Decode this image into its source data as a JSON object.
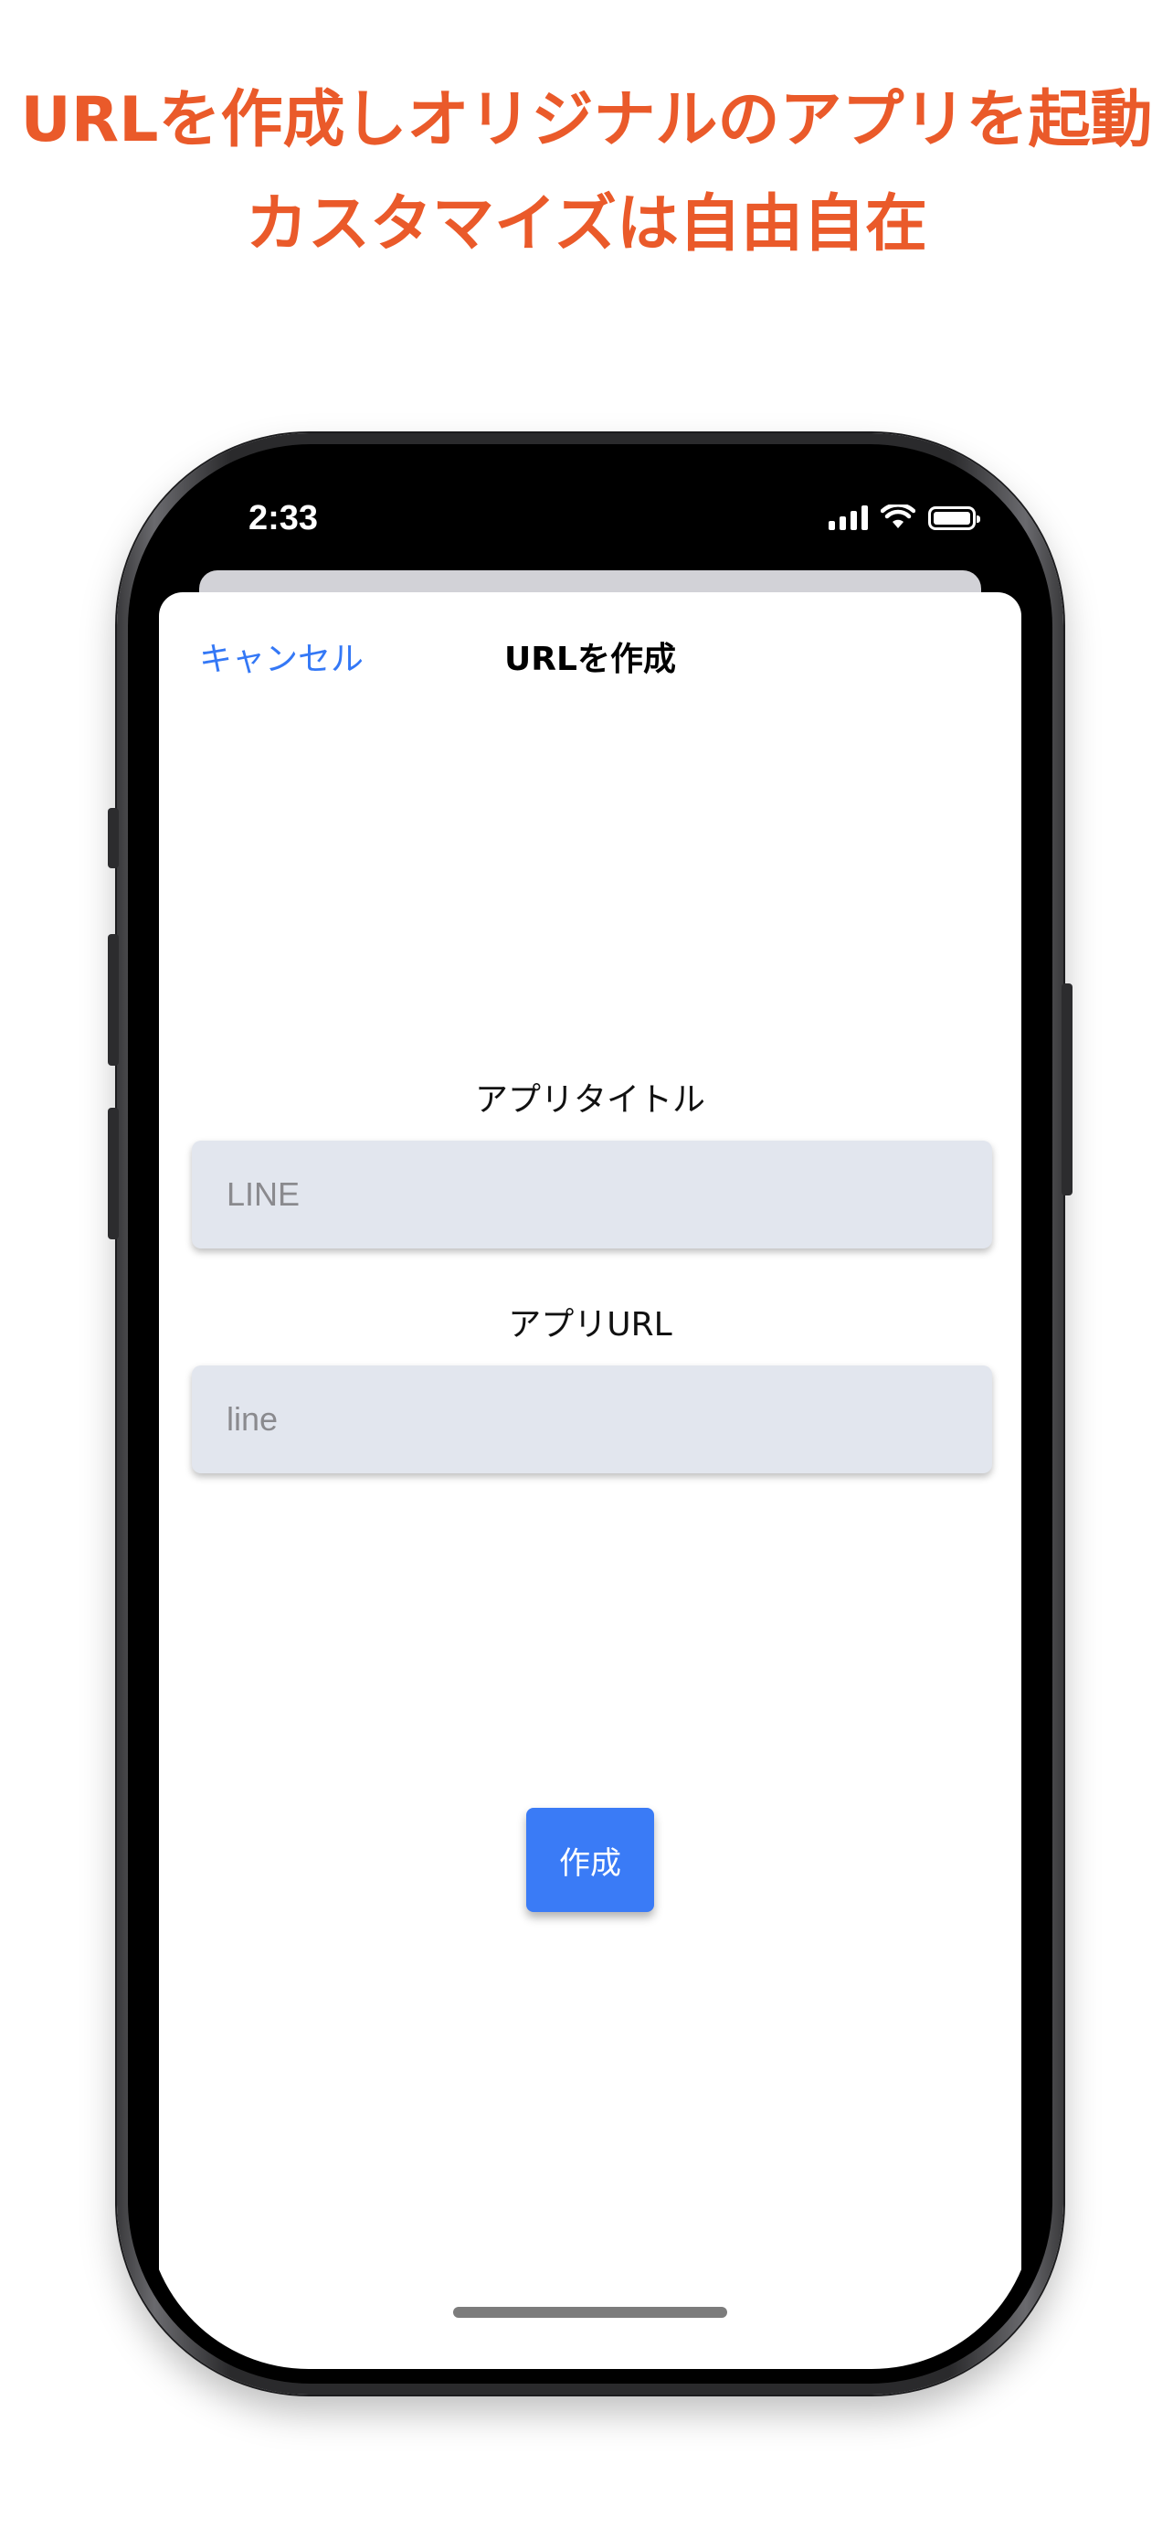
{
  "headline": {
    "line1": "URLを作成しオリジナルのアプリを起動",
    "line2": "カスタマイズは自由自在",
    "color": "#ea5a2a"
  },
  "status_bar": {
    "time": "2:33",
    "icons": [
      "signal-icon",
      "wifi-icon",
      "battery-icon"
    ]
  },
  "nav": {
    "cancel_label": "キャンセル",
    "title": "URLを作成",
    "accent_color": "#3478f6"
  },
  "form": {
    "title_label": "アプリタイトル",
    "title_placeholder": "LINE",
    "url_label": "アプリURL",
    "url_placeholder": "line",
    "submit_label": "作成",
    "button_color": "#3a7bf6"
  }
}
